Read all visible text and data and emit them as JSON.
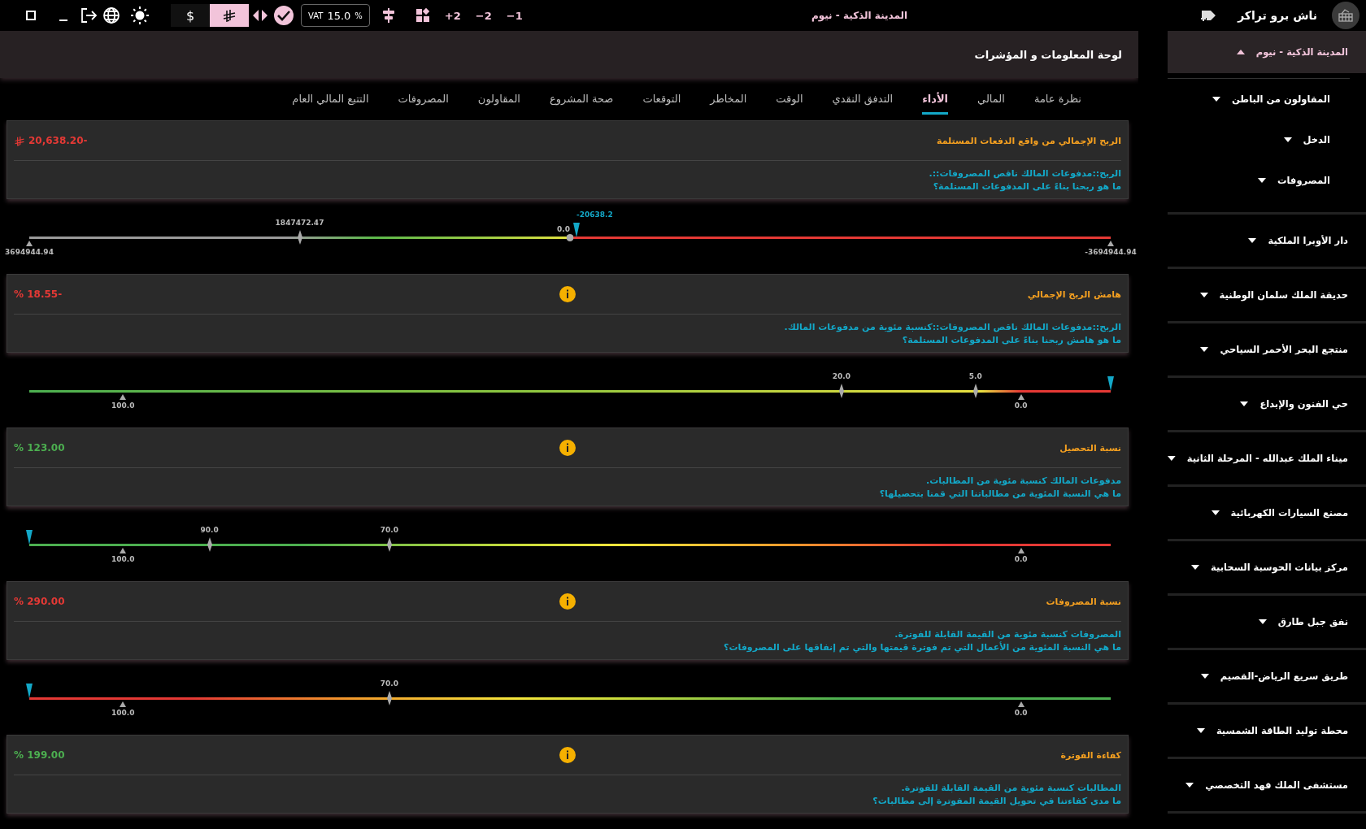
{
  "topbar": {
    "currencies": [
      {
        "kind": "text",
        "label": "$",
        "selected": false
      },
      {
        "kind": "riyal",
        "selected": true
      }
    ],
    "vat": {
      "label": "VAT",
      "value": "15.0",
      "unit": "%"
    },
    "steps": [
      "−1",
      "−2",
      "+2"
    ],
    "project_title": "المدينة الذكية - نيوم",
    "app_name": "ناش برو تراكر"
  },
  "header": {
    "title": "لوحة المعلومات و المؤشرات"
  },
  "tabs": [
    {
      "label": "نظرة عامة",
      "selected": false
    },
    {
      "label": "المالي",
      "selected": false
    },
    {
      "label": "الأداء",
      "selected": true
    },
    {
      "label": "التدفق النقدي",
      "selected": false
    },
    {
      "label": "الوقت",
      "selected": false
    },
    {
      "label": "المخاطر",
      "selected": false
    },
    {
      "label": "التوقعات",
      "selected": false
    },
    {
      "label": "صحة المشروع",
      "selected": false
    },
    {
      "label": "المقاولون",
      "selected": false
    },
    {
      "label": "المصروفات",
      "selected": false
    },
    {
      "label": "التتبع المالي العام",
      "selected": false
    }
  ],
  "metrics": [
    {
      "title": "الربح الإجمالي من واقع الدفعات المستلمة",
      "kind": "money",
      "value": "-20,638.20",
      "color": "#e53935",
      "info": false,
      "description": [
        "الربح::مدفوعات المالك ناقص المصروفات::.",
        "ما هو ربحنا بناءً على المدفوعات المستلمة؟"
      ],
      "gauge": {
        "kind": "profit",
        "pointer": {
          "level": 0.506,
          "label": "-20638.2"
        },
        "ticks": [
          {
            "kind": "lower",
            "level": 0,
            "label": "3694944.94"
          },
          {
            "kind": "upper",
            "level": 0.25,
            "label": "1847472.47"
          },
          {
            "kind": "origin",
            "level": 0.5,
            "label": "0.0"
          },
          {
            "kind": "lower",
            "level": 1,
            "label": "-3694944.94"
          }
        ]
      }
    },
    {
      "title": "هامش الربح الإجمالي",
      "kind": "percent",
      "value": "-18.55 %",
      "color": "#e53935",
      "info": true,
      "description": [
        "الربح::مدفوعات المالك ناقص المصروفات::كنسبة مئوية من مدفوعات المالك.",
        "ما هو هامش ربحنا بناءً على المدفوعات المستلمة؟"
      ],
      "gauge": {
        "kind": "margin",
        "pointer": {
          "level": 1
        },
        "ticks": [
          {
            "kind": "lower",
            "level": 0.0866,
            "label": "100.0"
          },
          {
            "kind": "upper",
            "level": 0.751,
            "label": "20.0"
          },
          {
            "kind": "upper",
            "level": 0.875,
            "label": "5.0"
          },
          {
            "kind": "lower",
            "level": 0.917,
            "label": "0.0"
          }
        ]
      }
    },
    {
      "title": "نسبة التحصيل",
      "kind": "percent",
      "value": "123.00 %",
      "color": "#4caf50",
      "info": true,
      "description": [
        "مدفوعات المالك كنسبة مئوية من المطالبات.",
        "ما هي النسبة المئوية من مطالباتنا التي قمنا بتحصيلها؟"
      ],
      "gauge": {
        "kind": "ascending",
        "pointer": {
          "level": 0
        },
        "ticks": [
          {
            "kind": "lower",
            "level": 0.0866,
            "label": "100.0"
          },
          {
            "kind": "upper",
            "level": 0.1667,
            "label": "90.0"
          },
          {
            "kind": "upper",
            "level": 0.333,
            "label": "70.0"
          },
          {
            "kind": "lower",
            "level": 0.917,
            "label": "0.0"
          }
        ]
      }
    },
    {
      "title": "نسبة المصروفات",
      "kind": "percent",
      "value": "290.00 %",
      "color": "#e53935",
      "info": true,
      "description": [
        "المصروفات كنسبة مئوية من القيمة القابلة للفوترة.",
        "ما هي النسبة المئوية من الأعمال التي تم فوترة قيمتها والتي تم إنفاقها على المصروفات؟"
      ],
      "gauge": {
        "kind": "descending",
        "pointer": {
          "level": 0
        },
        "ticks": [
          {
            "kind": "lower",
            "level": 0.0866,
            "label": "100.0"
          },
          {
            "kind": "upper",
            "level": 0.333,
            "label": "70.0"
          },
          {
            "kind": "lower",
            "level": 0.917,
            "label": "0.0"
          }
        ]
      }
    },
    {
      "title": "كفاءة الفوترة",
      "kind": "percent",
      "value": "199.00 %",
      "color": "#4caf50",
      "info": true,
      "description": [
        "المطالبات كنسبة مئوية من القيمة القابلة للفوترة.",
        "ما مدى كفاءتنا في تحويل القيمة المفوترة إلى مطالبات؟"
      ]
    }
  ],
  "sidebar": {
    "items": [
      {
        "label": "المدينة الذكية - نيوم",
        "expanded": true,
        "children": [
          {
            "label": "المقاولون من الباطن",
            "expanded": false
          },
          {
            "label": "الدخل",
            "expanded": false
          },
          {
            "label": "المصروفات",
            "expanded": false
          }
        ]
      },
      {
        "label": "دار الأوبرا الملكية",
        "expanded": false
      },
      {
        "label": "حديقة الملك سلمان الوطنية",
        "expanded": false
      },
      {
        "label": "منتجع البحر الأحمر السياحي",
        "expanded": false
      },
      {
        "label": "حي الفنون والإبداع",
        "expanded": false
      },
      {
        "label": "ميناء الملك عبدالله - المرحلة الثانية",
        "expanded": false
      },
      {
        "label": "مصنع السيارات الكهربائية",
        "expanded": false
      },
      {
        "label": "مركز بيانات الحوسبة السحابية",
        "expanded": false
      },
      {
        "label": "نفق جبل طارق",
        "expanded": false
      },
      {
        "label": "طريق سريع الرياض-القصيم",
        "expanded": false
      },
      {
        "label": "محطة توليد الطاقة الشمسية",
        "expanded": false
      },
      {
        "label": "مستشفى الملك فهد التخصصي",
        "expanded": false
      }
    ]
  }
}
